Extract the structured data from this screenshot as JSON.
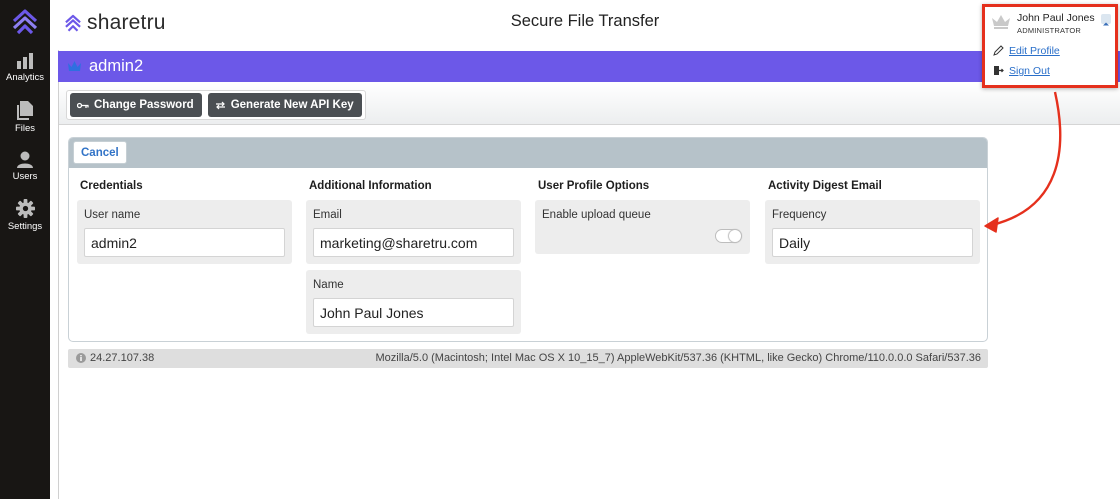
{
  "nav": {
    "logo_icon": "sharetru-logo-icon",
    "items": [
      {
        "label": "Analytics",
        "icon": "bar-chart-icon"
      },
      {
        "label": "Files",
        "icon": "file-icon"
      },
      {
        "label": "Users",
        "icon": "user-icon"
      },
      {
        "label": "Settings",
        "icon": "gear-icon"
      }
    ]
  },
  "header": {
    "brand": "sharetru",
    "title": "Secure File Transfer"
  },
  "user_bar": {
    "name": "admin2",
    "color": "#6c58e8"
  },
  "toolbar": {
    "change_password": "Change Password",
    "generate_api_key": "Generate New API Key"
  },
  "form": {
    "cancel": "Cancel",
    "sections": {
      "credentials": "Credentials",
      "additional": "Additional Information",
      "profile_options": "User Profile Options",
      "digest": "Activity Digest Email"
    },
    "username": {
      "label": "User name",
      "value": "admin2"
    },
    "email": {
      "label": "Email",
      "value": "marketing@sharetru.com"
    },
    "name": {
      "label": "Name",
      "value": "John Paul Jones"
    },
    "upload_queue": {
      "label": "Enable upload queue",
      "enabled": false
    },
    "frequency": {
      "label": "Frequency",
      "value": "Daily"
    }
  },
  "infobar": {
    "ip": "24.27.107.38",
    "user_agent": "Mozilla/5.0 (Macintosh; Intel Mac OS X 10_15_7) AppleWebKit/537.36 (KHTML, like Gecko) Chrome/110.0.0.0 Safari/537.36"
  },
  "profile_menu": {
    "name": "John Paul Jones",
    "role": "ADMINISTRATOR",
    "edit_profile": "Edit Profile",
    "sign_out": "Sign Out",
    "highlight_color": "#e5301d"
  }
}
